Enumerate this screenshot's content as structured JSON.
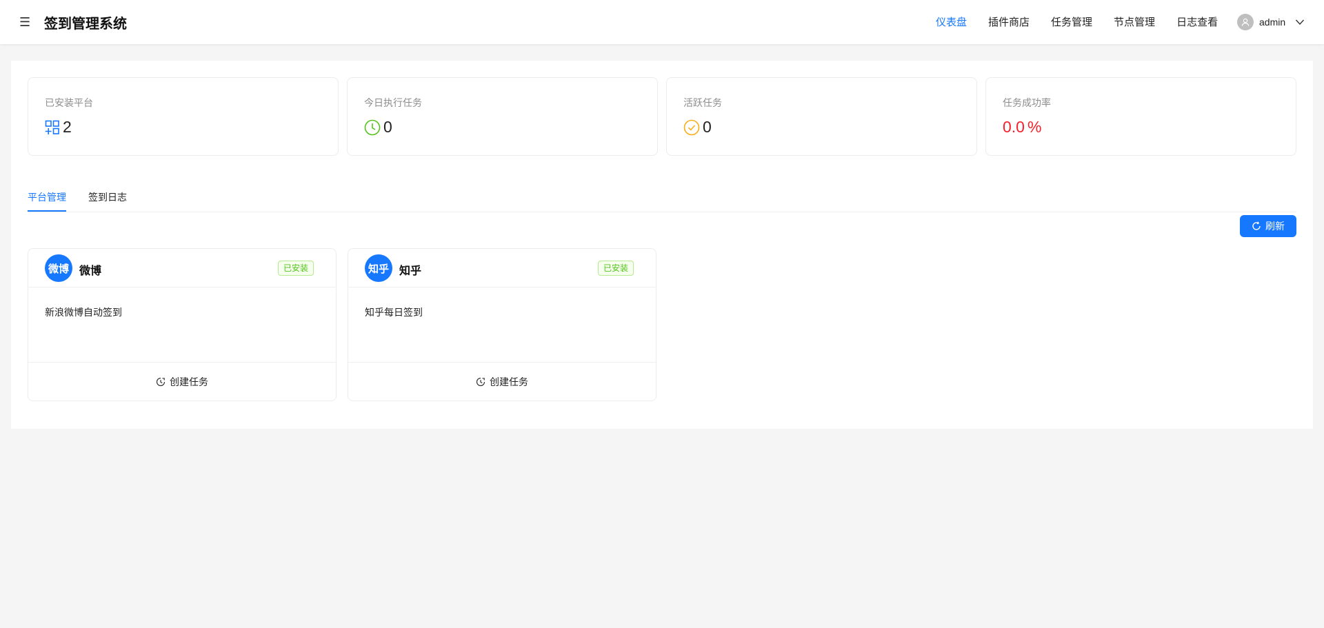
{
  "app": {
    "title": "签到管理系统"
  },
  "nav": {
    "items": [
      {
        "label": "仪表盘",
        "active": true
      },
      {
        "label": "插件商店",
        "active": false
      },
      {
        "label": "任务管理",
        "active": false
      },
      {
        "label": "节点管理",
        "active": false
      },
      {
        "label": "日志查看",
        "active": false
      }
    ]
  },
  "user": {
    "name": "admin"
  },
  "stats": [
    {
      "title": "已安装平台",
      "value": "2",
      "icon": "appstore-icon"
    },
    {
      "title": "今日执行任务",
      "value": "0",
      "icon": "clock-icon"
    },
    {
      "title": "活跃任务",
      "value": "0",
      "icon": "check-circle-icon"
    },
    {
      "title": "任务成功率",
      "value": "0.0",
      "suffix": "%",
      "value_color": "#f5222d"
    }
  ],
  "tabs": [
    {
      "label": "平台管理",
      "active": true
    },
    {
      "label": "签到日志",
      "active": false
    }
  ],
  "toolbar": {
    "refresh_label": "刷新"
  },
  "platforms": [
    {
      "logo_text": "微博",
      "name": "微博",
      "status": "已安装",
      "description": "新浪微博自动签到",
      "action": "创建任务"
    },
    {
      "logo_text": "知乎",
      "name": "知乎",
      "status": "已安装",
      "description": "知乎每日签到",
      "action": "创建任务"
    }
  ],
  "colors": {
    "primary": "#1677ff",
    "success": "#52c41a",
    "warning": "#faad14",
    "danger": "#f5222d"
  }
}
